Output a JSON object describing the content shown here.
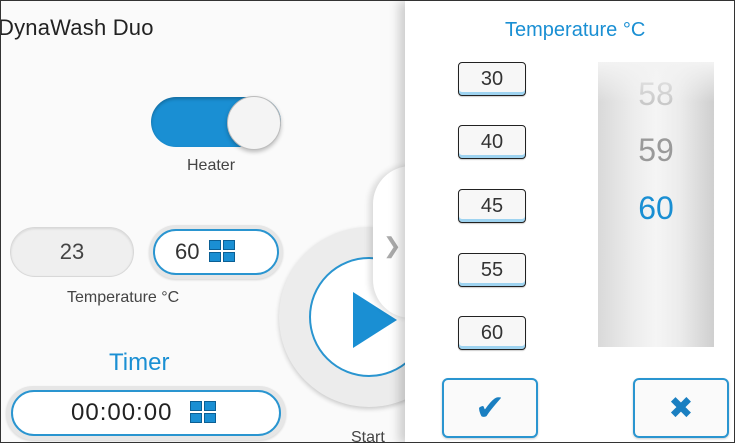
{
  "app": {
    "title": "DynaWash Duo"
  },
  "heater": {
    "label": "Heater",
    "on": true
  },
  "temperature": {
    "current": "23",
    "setpoint": "60",
    "label": "Temperature °C"
  },
  "timer": {
    "title": "Timer",
    "value": "00:00:00"
  },
  "start": {
    "label": "Start"
  },
  "colors": {
    "accent": "#1a8fd3",
    "background": "#fafafa",
    "panel": "#ffffff"
  },
  "picker": {
    "title": "Temperature °C",
    "presets": [
      "30",
      "40",
      "45",
      "55",
      "60"
    ],
    "wheel": {
      "prev2": "58",
      "prev1": "59",
      "selected": "60"
    },
    "confirm_icon": "checkmark-icon",
    "cancel_icon": "close-icon"
  },
  "icons": {
    "keypad": "keypad-icon",
    "play": "play-icon",
    "chevron": "chevron-right-icon"
  }
}
